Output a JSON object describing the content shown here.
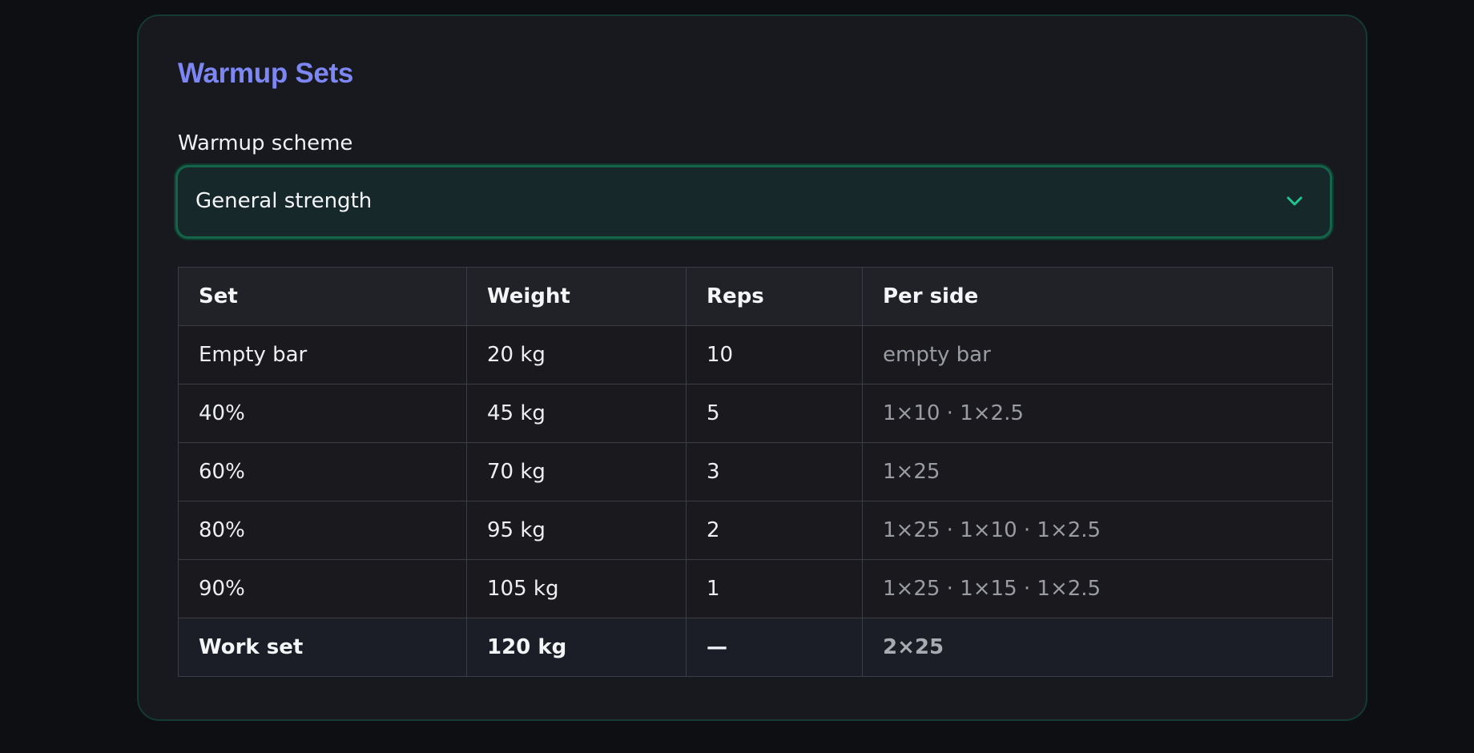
{
  "panel": {
    "title": "Warmup Sets",
    "scheme_label": "Warmup scheme",
    "scheme_value": "General strength",
    "chevron_icon": "chevron-down-icon",
    "accent_color": "#7d87f3",
    "select_accent": "#1fc58c"
  },
  "table": {
    "headers": [
      "Set",
      "Weight",
      "Reps",
      "Per side"
    ],
    "rows": [
      [
        "Empty bar",
        "20 kg",
        "10",
        "empty bar"
      ],
      [
        "40%",
        "45 kg",
        "5",
        "1×10 · 1×2.5"
      ],
      [
        "60%",
        "70 kg",
        "3",
        "1×25"
      ],
      [
        "80%",
        "95 kg",
        "2",
        "1×25 · 1×10 · 1×2.5"
      ],
      [
        "90%",
        "105 kg",
        "1",
        "1×25 · 1×15 · 1×2.5"
      ],
      [
        "Work set",
        "120 kg",
        "—",
        "2×25"
      ]
    ]
  }
}
